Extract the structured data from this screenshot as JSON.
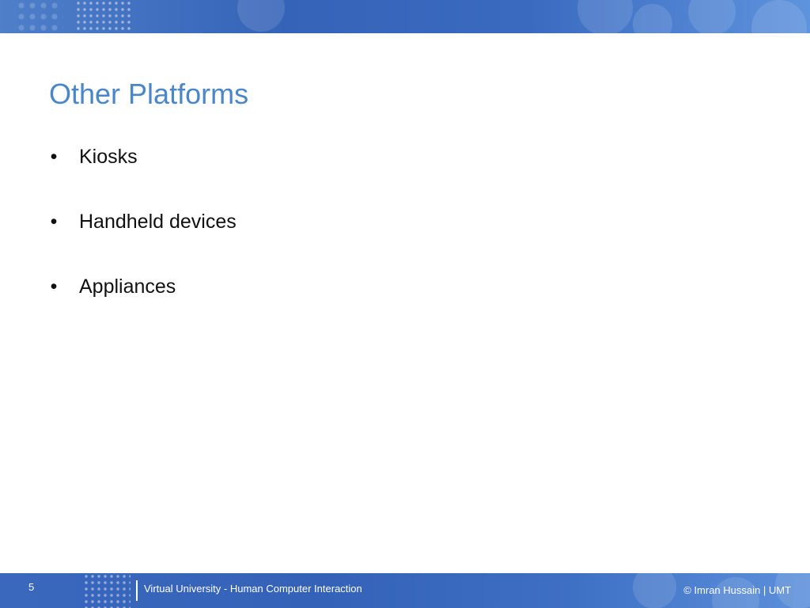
{
  "slide": {
    "title": "Other Platforms",
    "bullets": [
      {
        "symbol": "•",
        "text": "Kiosks"
      },
      {
        "symbol": "•",
        "text": "Handheld devices"
      },
      {
        "symbol": "•",
        "text": "Appliances"
      }
    ]
  },
  "footer": {
    "page_number": "5",
    "center_text": "Virtual University - Human Computer Interaction",
    "right_text": "© Imran Hussain | UMT"
  },
  "colors": {
    "title": "#4a86c8",
    "banner": "#3563b8",
    "text": "#111111"
  }
}
